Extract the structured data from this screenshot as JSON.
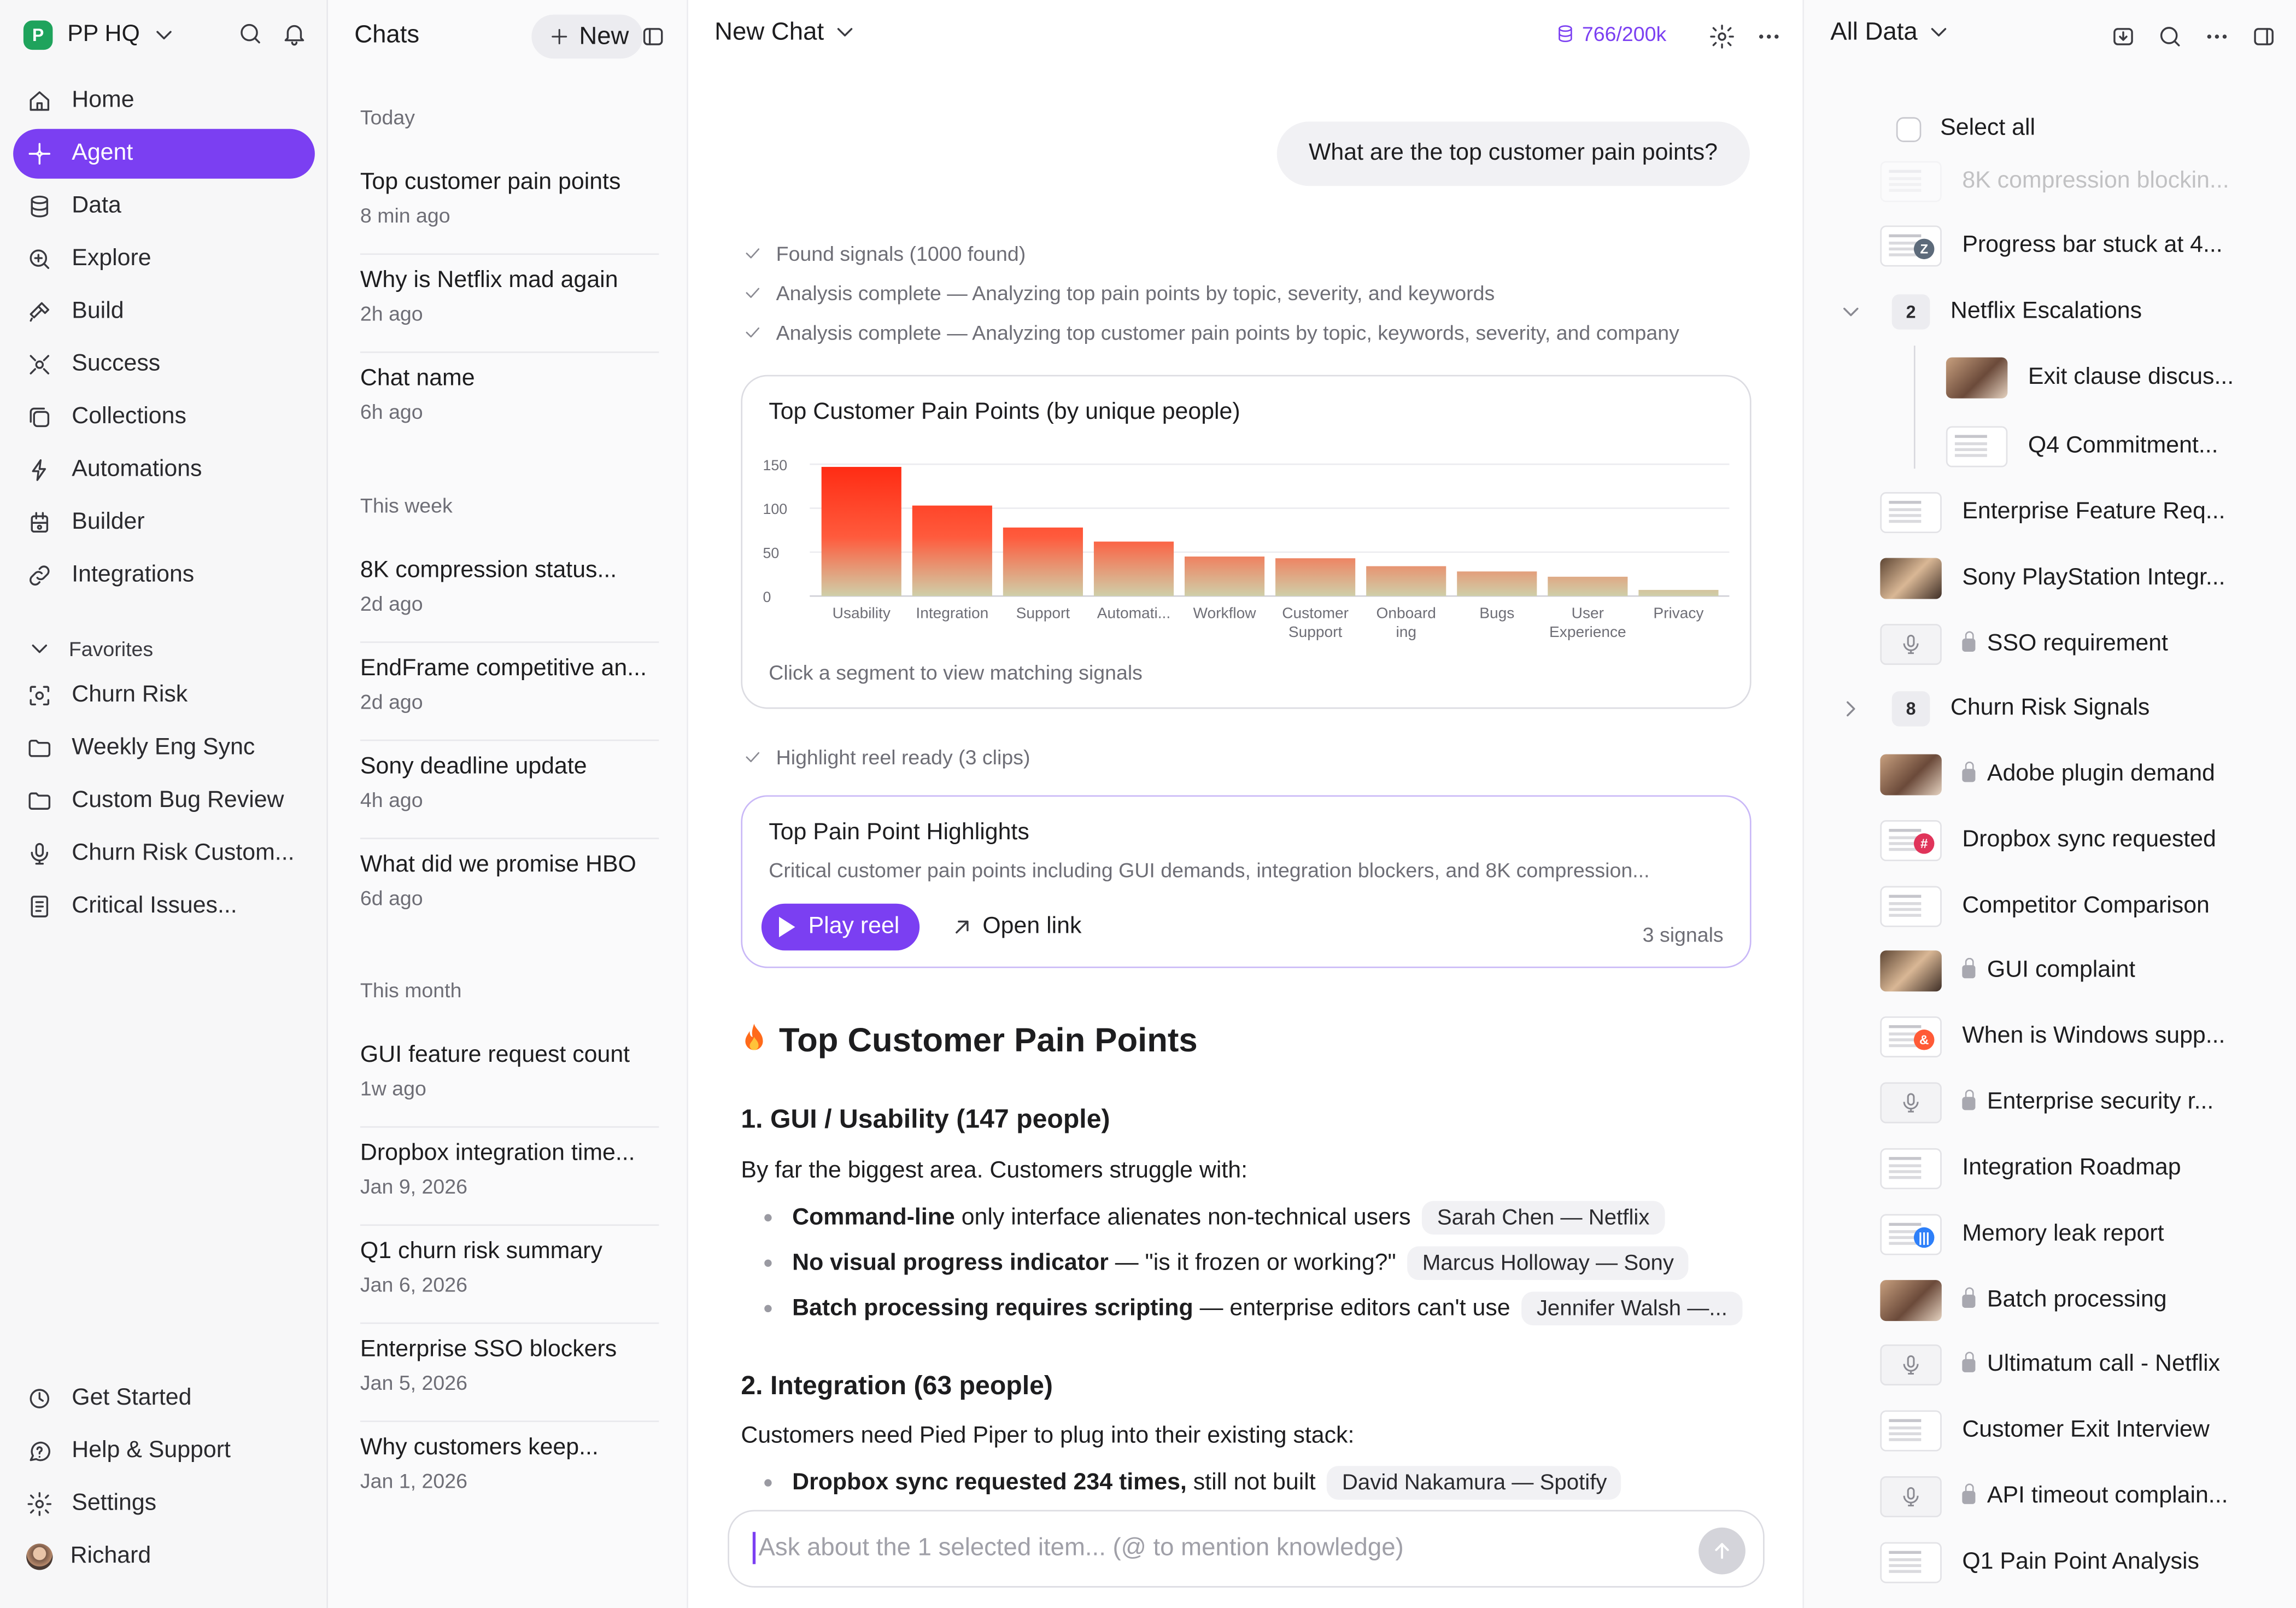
{
  "workspace": {
    "name": "PP HQ",
    "logo_letter": "P"
  },
  "nav": [
    {
      "label": "Home",
      "icon": "home-icon"
    },
    {
      "label": "Agent",
      "icon": "sparkle-icon",
      "active": true
    },
    {
      "label": "Data",
      "icon": "database-icon"
    },
    {
      "label": "Explore",
      "icon": "zoom-icon"
    },
    {
      "label": "Build",
      "icon": "hammer-icon"
    },
    {
      "label": "Success",
      "icon": "success-icon"
    },
    {
      "label": "Collections",
      "icon": "collections-icon"
    },
    {
      "label": "Automations",
      "icon": "automation-icon"
    },
    {
      "label": "Builder",
      "icon": "builder-icon"
    },
    {
      "label": "Integrations",
      "icon": "link-icon"
    }
  ],
  "favorites": {
    "label": "Favorites",
    "items": [
      {
        "label": "Churn Risk"
      },
      {
        "label": "Weekly Eng Sync"
      },
      {
        "label": "Custom Bug Review"
      },
      {
        "label": "Churn Risk Custom..."
      },
      {
        "label": "Critical Issues..."
      }
    ]
  },
  "bottom_nav": [
    {
      "label": "Get Started"
    },
    {
      "label": "Help & Support"
    },
    {
      "label": "Settings"
    },
    {
      "label": "Richard"
    }
  ],
  "chats": {
    "title": "Chats",
    "new_label": "New",
    "groups": [
      {
        "label": "Today",
        "items": [
          {
            "title": "Top customer pain points",
            "time": "8 min ago"
          },
          {
            "title": "Why is Netflix mad again",
            "time": "2h ago"
          },
          {
            "title": "Chat name",
            "time": "6h ago"
          }
        ]
      },
      {
        "label": "This week",
        "items": [
          {
            "title": "8K compression status...",
            "time": "2d ago"
          },
          {
            "title": "EndFrame competitive an...",
            "time": "2d ago"
          },
          {
            "title": "Sony deadline update",
            "time": "4h ago"
          },
          {
            "title": "What did we promise HBO",
            "time": "6d ago"
          }
        ]
      },
      {
        "label": "This month",
        "items": [
          {
            "title": "GUI feature request count",
            "time": "1w ago"
          },
          {
            "title": "Dropbox integration time...",
            "time": "Jan 9, 2026"
          },
          {
            "title": "Q1 churn risk summary",
            "time": "Jan 6, 2026"
          },
          {
            "title": "Enterprise SSO blockers",
            "time": "Jan 5, 2026"
          },
          {
            "title": "Why customers keep...",
            "time": "Jan 1, 2026"
          }
        ]
      }
    ]
  },
  "main": {
    "title": "New Chat",
    "tokens": "766/200k",
    "user_message": "What are the top customer pain points?",
    "steps": [
      "Found signals (1000 found)",
      "Analysis complete — Analyzing top pain points by topic, severity, and keywords",
      "Analysis complete — Analyzing top customer pain points by topic, keywords, severity, and company"
    ],
    "chart_card": {
      "title": "Top Customer Pain Points (by unique people)",
      "hint": "Click a segment to view matching signals"
    },
    "highlight_step": "Highlight reel ready (3 clips)",
    "highlight_card": {
      "title": "Top Pain Point Highlights",
      "desc": "Critical customer pain points including GUI demands, integration blockers, and 8K compression...",
      "play": "Play reel",
      "open": "Open link",
      "count": "3 signals"
    },
    "answer": {
      "heading": "Top Customer Pain Points",
      "sec1": "1. GUI / Usability (147 people)",
      "sec1_intro": "By far the biggest area. Customers struggle with:",
      "sec1_bullets": [
        {
          "bold": "Command-line",
          "rest": " only interface alienates non-technical users",
          "chip": "Sarah Chen — Netflix"
        },
        {
          "bold": "No visual progress indicator",
          "rest": " — \"is it frozen or working?\"",
          "chip": "Marcus Holloway — Sony"
        },
        {
          "bold": "Batch processing requires scripting",
          "rest": " — enterprise editors can't use",
          "chip": "Jennifer Walsh —..."
        }
      ],
      "sec2": "2. Integration (63 people)",
      "sec2_intro": "Customers need Pied Piper to plug into their existing stack:",
      "sec2_bullets": [
        {
          "bold": "Dropbox sync requested 234 times,",
          "rest": " still not built",
          "chip": "David Nakamura — Spotify"
        }
      ]
    },
    "composer_placeholder": "Ask about the 1 selected item... (@ to mention knowledge)"
  },
  "chart_data": {
    "type": "bar",
    "title": "Top Customer Pain Points (by unique people)",
    "categories": [
      "Usability",
      "Integration",
      "Support",
      "Automati...",
      "Workflow",
      "Customer Support",
      "Onboarding",
      "Bugs",
      "User Experience",
      "Privacy"
    ],
    "tick_labels": [
      [
        "Usability"
      ],
      [
        "Integration"
      ],
      [
        "Support"
      ],
      [
        "Automati..."
      ],
      [
        "Workflow"
      ],
      [
        "Customer",
        "Support"
      ],
      [
        "Onboard",
        "ing"
      ],
      [
        "Bugs"
      ],
      [
        "User",
        "Experience"
      ],
      [
        "Privacy"
      ]
    ],
    "values": [
      147,
      103,
      78,
      62,
      45,
      43,
      34,
      28,
      22,
      7
    ],
    "ylim": [
      0,
      150
    ],
    "yticks": [
      0,
      50,
      100,
      150
    ],
    "grid": true,
    "legend": "none",
    "colors": {
      "top": "#ff2a12",
      "bottom": "#cfcfa9"
    }
  },
  "right": {
    "title": "All Data",
    "select_all": "Select all",
    "items": [
      {
        "label": "8K compression blockin...",
        "thumb": "doc",
        "faded": true
      },
      {
        "label": "Progress bar stuck at 4...",
        "thumb": "doc",
        "badge": "Z",
        "badge_color": "#5c6a7a"
      },
      {
        "label": "Netflix Escalations",
        "type": "folder",
        "count": "2",
        "expanded": true
      },
      {
        "label": "Exit clause discus...",
        "thumb": "photo",
        "indent": true
      },
      {
        "label": "Q4 Commitment...",
        "thumb": "doc",
        "indent": true
      },
      {
        "label": "Enterprise Feature Req...",
        "thumb": "doc"
      },
      {
        "label": "Sony PlayStation Integr...",
        "thumb": "photo2"
      },
      {
        "label": "SSO requirement",
        "thumb": "mic",
        "locked": true
      },
      {
        "label": "Churn Risk Signals",
        "type": "folder",
        "count": "8",
        "expanded": false
      },
      {
        "label": "Adobe plugin demand",
        "thumb": "photo",
        "locked": true
      },
      {
        "label": "Dropbox sync requested",
        "thumb": "doc",
        "badge": "#",
        "badge_color": "#e0345a"
      },
      {
        "label": "Competitor Comparison",
        "thumb": "doc"
      },
      {
        "label": "GUI complaint",
        "thumb": "photo2",
        "locked": true
      },
      {
        "label": "When is Windows supp...",
        "thumb": "doc",
        "badge": "&",
        "badge_color": "#ff5a36"
      },
      {
        "label": "Enterprise security r...",
        "thumb": "mic",
        "locked": true
      },
      {
        "label": "Integration Roadmap",
        "thumb": "doc"
      },
      {
        "label": "Memory leak report",
        "thumb": "doc",
        "badge": "|||",
        "badge_color": "#2d7ff9"
      },
      {
        "label": "Batch processing",
        "thumb": "photo",
        "locked": true
      },
      {
        "label": "Ultimatum call - Netflix",
        "thumb": "mic",
        "locked": true
      },
      {
        "label": "Customer Exit Interview",
        "thumb": "doc"
      },
      {
        "label": "API timeout complain...",
        "thumb": "mic",
        "locked": true
      },
      {
        "label": "Q1 Pain Point Analysis",
        "thumb": "doc"
      }
    ]
  }
}
